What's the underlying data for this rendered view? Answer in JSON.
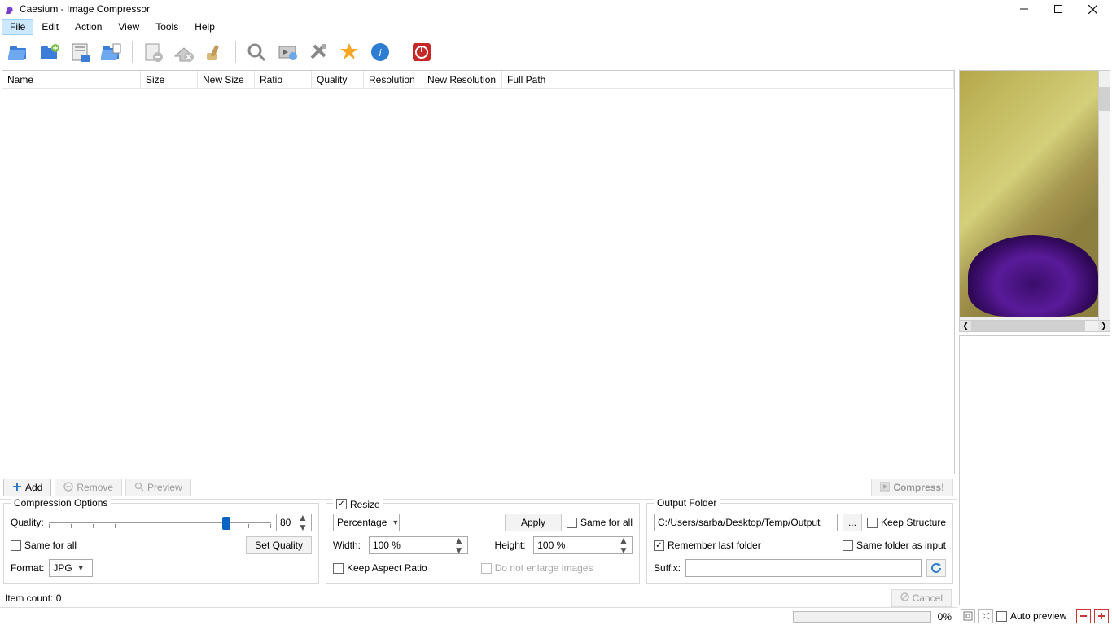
{
  "window": {
    "title": "Caesium - Image Compressor"
  },
  "menu": {
    "items": [
      "File",
      "Edit",
      "Action",
      "View",
      "Tools",
      "Help"
    ],
    "active_index": 0
  },
  "columns": {
    "name": "Name",
    "size": "Size",
    "new_size": "New Size",
    "ratio": "Ratio",
    "quality": "Quality",
    "resolution": "Resolution",
    "new_resolution": "New Resolution",
    "full_path": "Full Path"
  },
  "list_buttons": {
    "add": "Add",
    "remove": "Remove",
    "preview": "Preview",
    "compress": "Compress!"
  },
  "compression": {
    "title": "Compression Options",
    "quality_label": "Quality:",
    "quality_value": "80",
    "same_for_all": "Same for all",
    "set_quality": "Set Quality",
    "format_label": "Format:",
    "format_value": "JPG"
  },
  "resize": {
    "title": "Resize",
    "mode": "Percentage",
    "apply": "Apply",
    "same_for_all": "Same for all",
    "width_label": "Width:",
    "width_value": "100 %",
    "height_label": "Height:",
    "height_value": "100 %",
    "keep_aspect": "Keep Aspect Ratio",
    "no_enlarge": "Do not enlarge images"
  },
  "output": {
    "title": "Output Folder",
    "path": "C:/Users/sarba/Desktop/Temp/Output",
    "browse": "...",
    "keep_structure": "Keep Structure",
    "remember": "Remember last folder",
    "same_as_input": "Same folder as input",
    "suffix_label": "Suffix:",
    "suffix_value": ""
  },
  "bottom": {
    "item_count": "Item count: 0",
    "cancel": "Cancel"
  },
  "status": {
    "percent": "0%"
  },
  "preview": {
    "auto": "Auto preview"
  }
}
